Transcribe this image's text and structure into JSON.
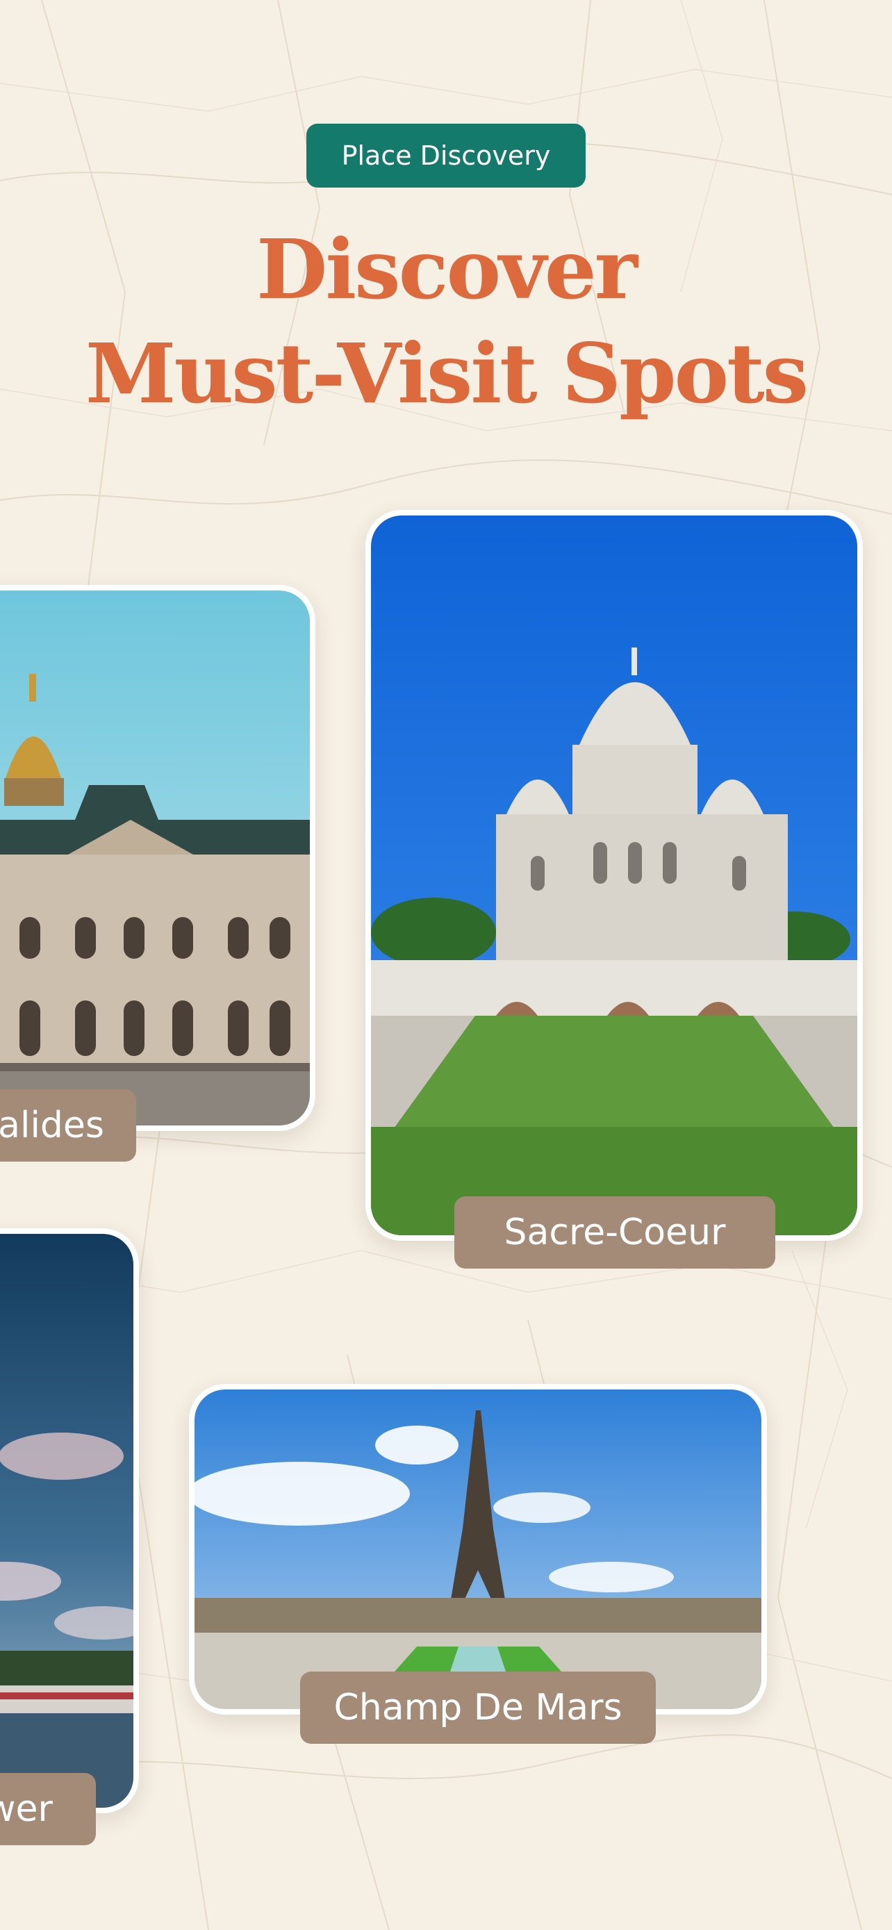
{
  "header": {
    "badge": "Place Discovery",
    "title_line1": "Discover",
    "title_line2": "Must-Visit Spots"
  },
  "cards": {
    "invalides": {
      "label": "alides",
      "image": "les-invalides-photo"
    },
    "sacre_coeur": {
      "label": "Sacre-Coeur",
      "image": "sacre-coeur-photo"
    },
    "eiffel_tower": {
      "label": "wer",
      "image": "eiffel-tower-river-photo"
    },
    "champ_de_mars": {
      "label": "Champ De Mars",
      "image": "champ-de-mars-photo"
    }
  },
  "colors": {
    "background": "#f6efe4",
    "badge": "#137a6c",
    "headline": "#dd6a3c",
    "label": "#a48b78"
  }
}
